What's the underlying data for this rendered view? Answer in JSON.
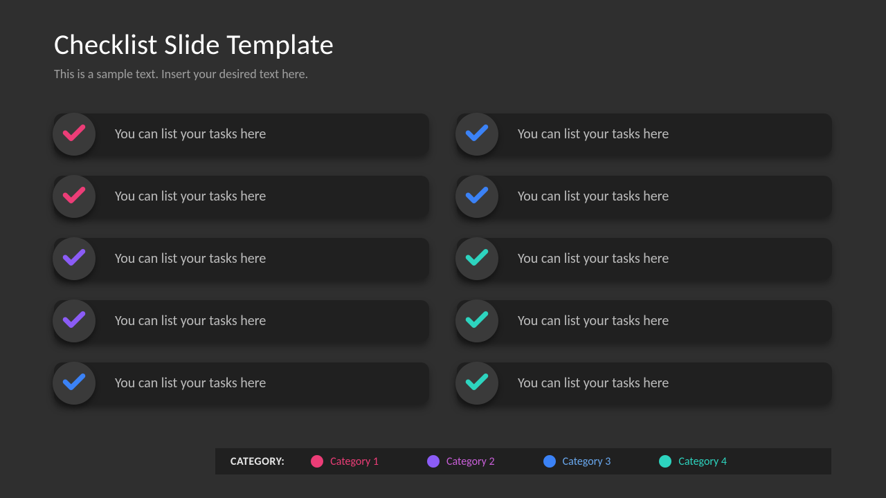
{
  "title": "Checklist Slide Template",
  "subtitle": "This is a sample text. Insert your desired text here.",
  "colors": {
    "cat1": "#ec3d77",
    "cat2": "#8b5cf6",
    "cat3": "#3b82f6",
    "cat4": "#2dd4bf"
  },
  "leftItems": [
    {
      "text": "You can list your tasks here",
      "colorKey": "cat1"
    },
    {
      "text": "You can list your tasks here",
      "colorKey": "cat1"
    },
    {
      "text": "You can list your tasks here",
      "colorKey": "cat2"
    },
    {
      "text": "You can list your tasks here",
      "colorKey": "cat2"
    },
    {
      "text": "You can list your tasks here",
      "colorKey": "cat3"
    }
  ],
  "rightItems": [
    {
      "text": "You can list your tasks here",
      "colorKey": "cat3"
    },
    {
      "text": "You can list your tasks here",
      "colorKey": "cat3"
    },
    {
      "text": "You can list your tasks here",
      "colorKey": "cat4"
    },
    {
      "text": "You can list your tasks here",
      "colorKey": "cat4"
    },
    {
      "text": "You can list your tasks here",
      "colorKey": "cat4"
    }
  ],
  "legend": {
    "label": "CATEGORY:",
    "items": [
      {
        "text": "Category 1",
        "colorKey": "cat1",
        "textColor": "#ec3d77"
      },
      {
        "text": "Category 2",
        "colorKey": "cat2",
        "textColor": "#c95fd9"
      },
      {
        "text": "Category 3",
        "colorKey": "cat3",
        "textColor": "#6aa9f0"
      },
      {
        "text": "Category 4",
        "colorKey": "cat4",
        "textColor": "#2dd4bf"
      }
    ]
  }
}
